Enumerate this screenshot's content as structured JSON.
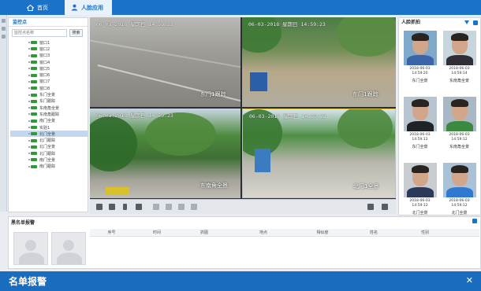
{
  "tabs": [
    {
      "label": "首页",
      "icon": "home-icon"
    },
    {
      "label": "人脸应用",
      "icon": "person-icon",
      "active": true
    }
  ],
  "left_panel": {
    "title": "监控点",
    "search_placeholder": "监控点名称",
    "search_button": "搜索",
    "items": [
      "窗口1",
      "窗口2",
      "窗口3",
      "窗口4",
      "窗口5",
      "窗口6",
      "窗口7",
      "窗口8",
      "东门全景",
      "东门跟踪",
      "东南角全景",
      "东南角跟踪",
      "南门全景",
      "实验1",
      "北门全景",
      "北门跟踪",
      "北门全景",
      "北门跟踪",
      "南门全景",
      "南门跟踪"
    ],
    "selected_index": 14
  },
  "videos": [
    {
      "timestamp": "06-03-2018 星期日 14:59:23",
      "label": ""
    },
    {
      "timestamp": "06-03-2018 星期日 14:59:23",
      "label": "东门1跟踪"
    },
    {
      "timestamp": "06-03-2018 星期日 14:59:23",
      "label": "东南角全景"
    },
    {
      "timestamp": "06-03-2018 星期日 14:59:23",
      "label": "北门1全景"
    }
  ],
  "video_label_left": "东门1跟踪",
  "face_panel": {
    "title": "人脸抓拍",
    "captures": [
      {
        "time": "2018-06-03\n14:59:20",
        "camera": "东门全景"
      },
      {
        "time": "2018-06-03\n14:59:14",
        "camera": "东南角全景"
      },
      {
        "time": "2018-06-03\n14:59:12",
        "camera": "东门全景"
      },
      {
        "time": "2018-06-03\n14:59:12",
        "camera": "东南角全景"
      },
      {
        "time": "2018-06-03\n14:59:12",
        "camera": "北门全景"
      },
      {
        "time": "2018-06-03\n14:59:12",
        "camera": "北门全景"
      }
    ]
  },
  "blacklist": {
    "title": "黑名单报警",
    "columns": [
      "序号",
      "时间",
      "抓图",
      "地点",
      "相似度",
      "姓名",
      "性别"
    ]
  },
  "banner": {
    "title": "名单报警",
    "close": "✕"
  }
}
